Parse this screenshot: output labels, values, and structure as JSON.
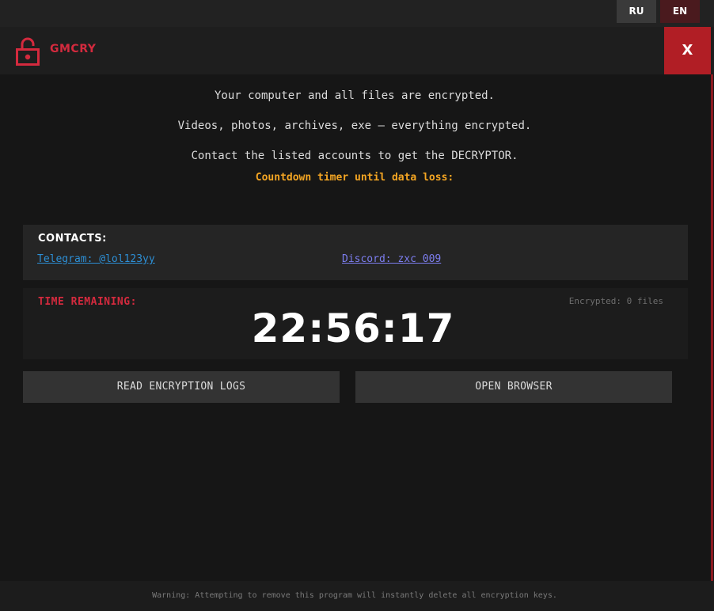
{
  "language": {
    "ru_label": "RU",
    "en_label": "EN"
  },
  "header": {
    "title": "GMCRY",
    "close_label": "X",
    "icon": "lock-icon"
  },
  "message": {
    "line1": "Your computer and all files are encrypted.",
    "line2": "Videos, photos, archives, exe — everything encrypted.",
    "line3": "Contact the listed accounts to get the DECRYPTOR.",
    "countdown_label": "Countdown timer until data loss:"
  },
  "contacts": {
    "title": "CONTACTS:",
    "telegram": "Telegram: @lol123yy",
    "discord": "Discord: zxc 009"
  },
  "timer": {
    "label": "TIME REMAINING:",
    "encrypted_count": "Encrypted: 0 files",
    "value": "22:56:17"
  },
  "buttons": {
    "logs_label": "READ ENCRYPTION LOGS",
    "browser_label": "OPEN BROWSER"
  },
  "footer": {
    "warning": "Warning: Attempting to remove this program will instantly delete all encryption keys."
  },
  "colors": {
    "accent_red": "#d42a3e",
    "close_red": "#b11e25",
    "countdown_orange": "#f5a623",
    "telegram_blue": "#2d8fd5",
    "discord_purple": "#7d7ef0"
  }
}
